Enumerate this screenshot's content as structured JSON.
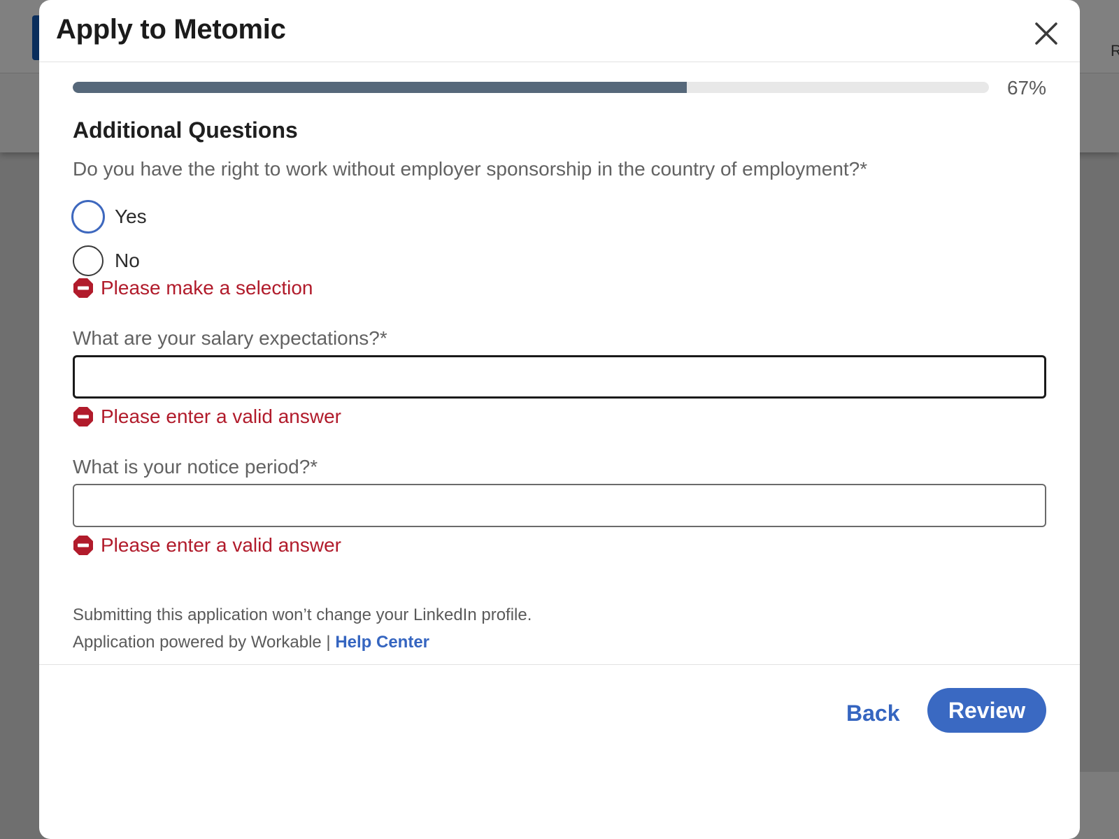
{
  "background": {
    "partial_letter": "R"
  },
  "modal": {
    "title": "Apply to Metomic",
    "progress": {
      "value": 0.67,
      "label": "67%"
    },
    "section_title": "Additional Questions",
    "questions": [
      {
        "label": "Do you have the right to work without employer sponsorship in the country of employment?*",
        "type": "radio",
        "options": [
          "Yes",
          "No"
        ],
        "focused_option": "Yes",
        "error": "Please make a selection"
      },
      {
        "label": "What are your salary expectations?*",
        "type": "text",
        "value": "",
        "focused": true,
        "error": "Please enter a valid answer"
      },
      {
        "label": "What is your notice period?*",
        "type": "text",
        "value": "",
        "focused": false,
        "error": "Please enter a valid answer"
      }
    ],
    "footer": {
      "note": "Submitting this application won’t change your LinkedIn profile.",
      "powered_by": "Application powered by Workable | ",
      "help_link": "Help Center"
    },
    "buttons": {
      "back": "Back",
      "review": "Review"
    }
  },
  "colors": {
    "accent": "#3a69c2",
    "error": "#b11b2b",
    "progress_fill": "#56687a",
    "progress_track": "#e8e8e8"
  },
  "icons": {
    "close": "close-icon",
    "error": "error-octagon-icon"
  }
}
